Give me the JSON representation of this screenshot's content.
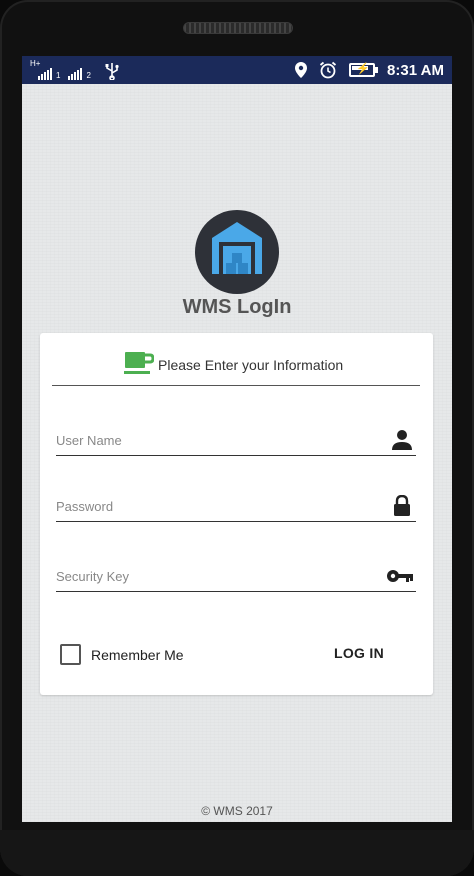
{
  "status_bar": {
    "network_type": "H+",
    "sim1_label": "1",
    "sim2_label": "2",
    "icons": [
      "signal-icon",
      "usb-icon",
      "location-icon",
      "alarm-icon",
      "battery-charging-icon"
    ],
    "time": "8:31 AM"
  },
  "app": {
    "logo_icon": "warehouse-icon",
    "title": "WMS LogIn",
    "accent_color": "#4caf50",
    "logo_blue": "#3a9be0"
  },
  "form": {
    "header_icon": "coffee-cup-icon",
    "header_text": "Please Enter your Information",
    "username_placeholder": "User Name",
    "username_icon": "person-icon",
    "password_placeholder": "Password",
    "password_icon": "lock-icon",
    "security_key_placeholder": "Security Key",
    "security_key_icon": "key-icon",
    "remember_label": "Remember Me",
    "remember_checked": false,
    "login_label": "LOG IN"
  },
  "footer": {
    "copyright": "© WMS 2017"
  }
}
